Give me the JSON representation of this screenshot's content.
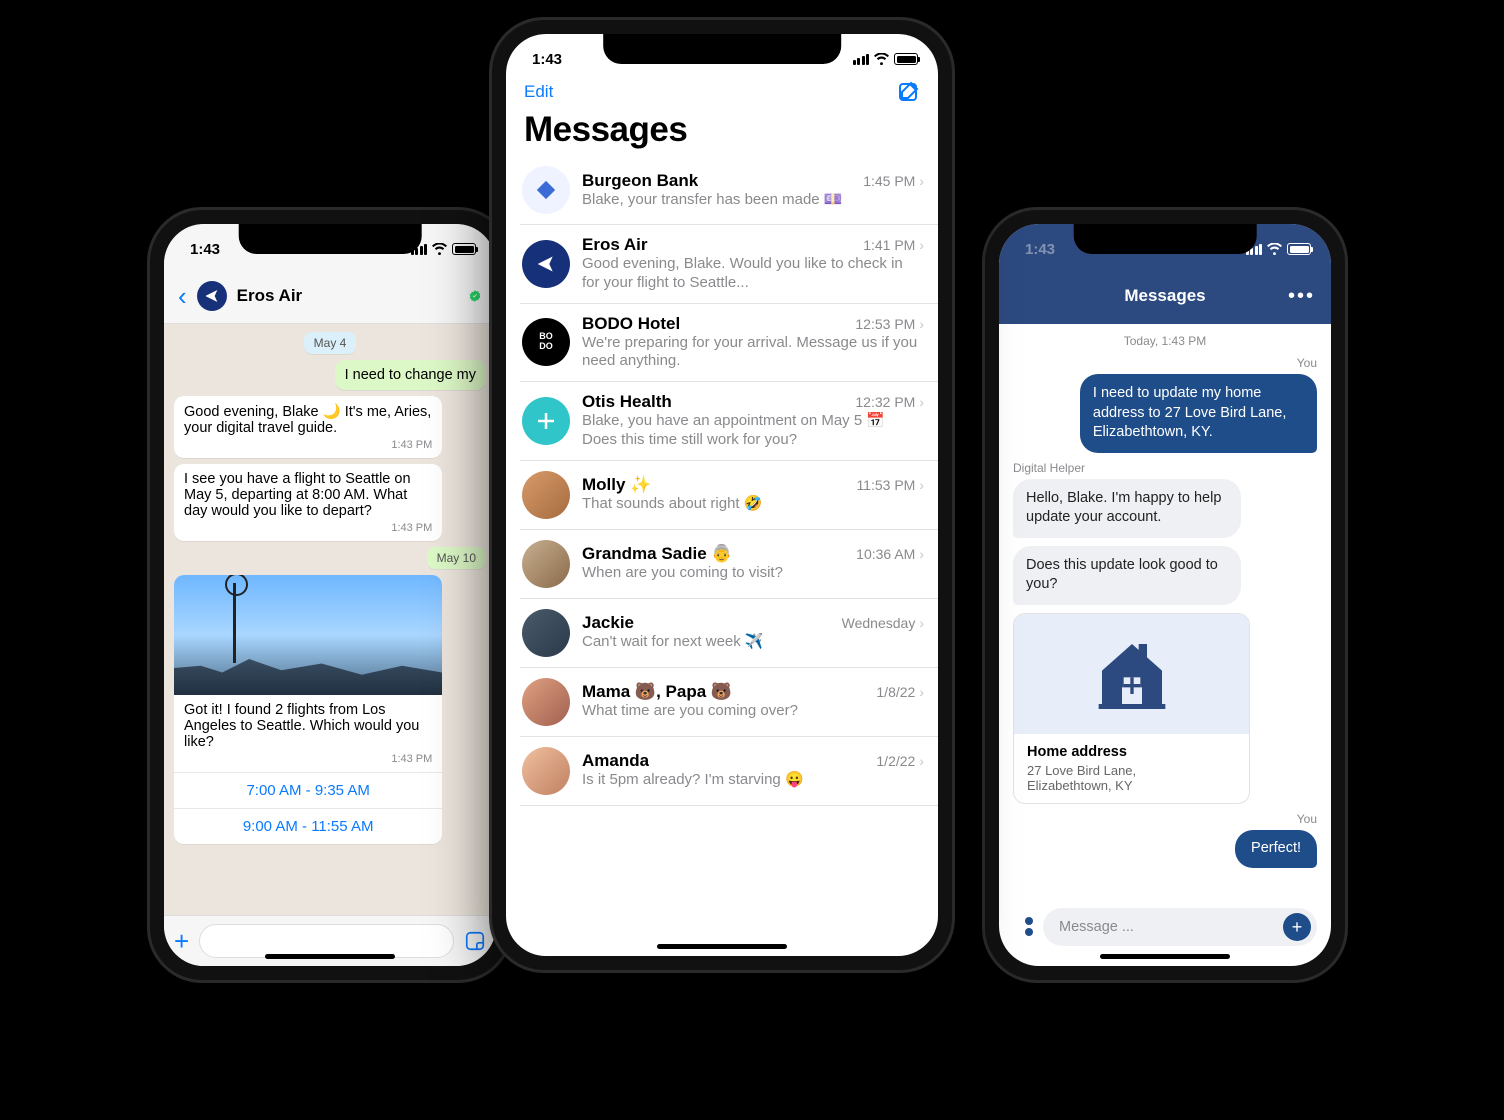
{
  "status_time": "1:43",
  "left": {
    "chat_name": "Eros Air",
    "date_chip_1": "May 4",
    "out_1": "I need to change my",
    "in_1": "Good evening, Blake 🌙 It's me, Aries, your digital travel guide.",
    "in_1_time": "1:43 PM",
    "in_2": "I see you have a flight to Seattle on May 5, departing at 8:00 AM. What day would you like to depart?",
    "in_2_time": "1:43 PM",
    "date_chip_2": "May 10",
    "img_caption": "Got it! I found 2 flights from Los Angeles to Seattle. Which would you like?",
    "img_time": "1:43 PM",
    "choice_1": "7:00 AM - 9:35 AM",
    "choice_2": "9:00 AM - 11:55 AM"
  },
  "center": {
    "edit_label": "Edit",
    "title": "Messages",
    "rows": [
      {
        "name": "Burgeon Bank",
        "time": "1:45 PM",
        "preview": "Blake, your transfer has been made 💷"
      },
      {
        "name": "Eros Air",
        "time": "1:41 PM",
        "preview": "Good evening, Blake. Would you like to check in for your flight to Seattle..."
      },
      {
        "name": "BODO Hotel",
        "time": "12:53 PM",
        "preview": "We're preparing for your arrival. Message us if you need anything."
      },
      {
        "name": "Otis Health",
        "time": "12:32 PM",
        "preview": "Blake, you have an appointment on May 5 📅 Does this time still work for you?"
      },
      {
        "name": "Molly ✨",
        "time": "11:53 PM",
        "preview": "That sounds about right 🤣"
      },
      {
        "name": "Grandma Sadie 👵",
        "time": "10:36 AM",
        "preview": "When are you coming to visit?"
      },
      {
        "name": "Jackie",
        "time": "Wednesday",
        "preview": "Can't wait for next week ✈️"
      },
      {
        "name": "Mama 🐻, Papa 🐻",
        "time": "1/8/22",
        "preview": "What time are you coming over?"
      },
      {
        "name": "Amanda",
        "time": "1/2/22",
        "preview": "Is it 5pm already? I'm starving 😛"
      }
    ]
  },
  "right": {
    "header_title": "Messages",
    "date": "Today, 1:43 PM",
    "label_you": "You",
    "out_1": "I need to update my home address to 27 Love Bird Lane, Elizabethtown, KY.",
    "label_helper": "Digital Helper",
    "in_1": "Hello, Blake. I'm happy to help update your account.",
    "in_2": "Does this update look good to you?",
    "card_title": "Home address",
    "card_body": "27 Love Bird Lane,\nElizabethtown, KY",
    "out_2": "Perfect!",
    "input_placeholder": "Message ..."
  }
}
